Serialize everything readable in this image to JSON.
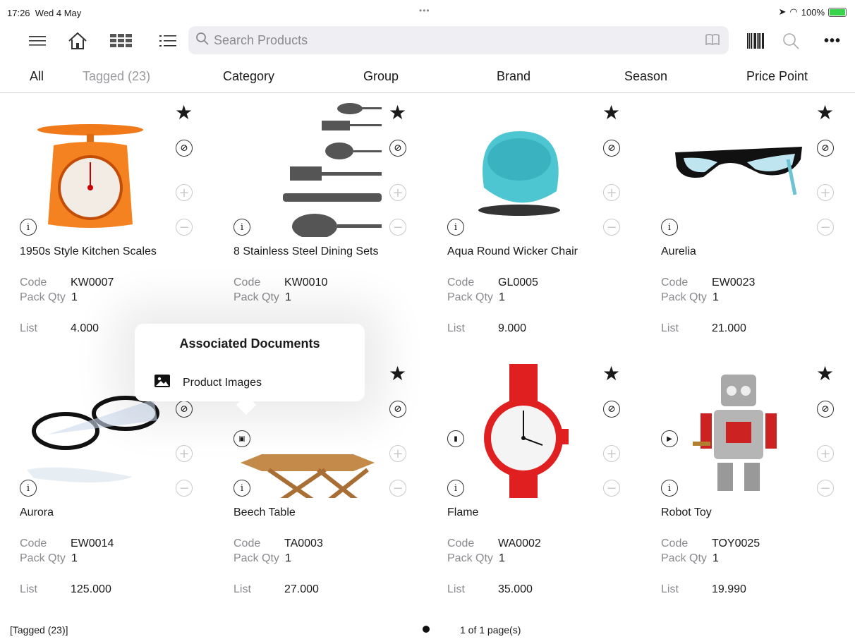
{
  "status_bar": {
    "time": "17:26",
    "date": "Wed 4 May",
    "battery": "100%",
    "dots": "•••"
  },
  "toolbar": {
    "search_placeholder": "Search Products",
    "icons": [
      "menu-icon",
      "home-icon",
      "grid-view-icon",
      "list-view-icon",
      "book-icon",
      "barcode-icon",
      "search-icon",
      "more-icon"
    ]
  },
  "filters": [
    "All",
    "Tagged (23)",
    "Category",
    "Group",
    "Brand",
    "Season",
    "Price Point"
  ],
  "labels": {
    "code": "Code",
    "pack_qty": "Pack Qty",
    "list": "List"
  },
  "products": [
    {
      "name": "1950s Style Kitchen Scales",
      "code": "KW0007",
      "pack_qty": "1",
      "list": "4.000"
    },
    {
      "name": "8 Stainless Steel Dining Sets",
      "code": "KW0010",
      "pack_qty": "1",
      "list": ""
    },
    {
      "name": "Aqua Round Wicker Chair",
      "code": "GL0005",
      "pack_qty": "1",
      "list": "9.000"
    },
    {
      "name": "Aurelia",
      "code": "EW0023",
      "pack_qty": "1",
      "list": "21.000"
    },
    {
      "name": "Aurora",
      "code": "EW0014",
      "pack_qty": "1",
      "list": "125.000"
    },
    {
      "name": "Beech Table",
      "code": "TA0003",
      "pack_qty": "1",
      "list": "27.000"
    },
    {
      "name": "Flame",
      "code": "WA0002",
      "pack_qty": "1",
      "list": "35.000"
    },
    {
      "name": "Robot Toy",
      "code": "TOY0025",
      "pack_qty": "1",
      "list": "19.990"
    }
  ],
  "popover": {
    "title": "Associated Documents",
    "item": "Product Images"
  },
  "footer": {
    "left": "[Tagged (23)]",
    "pages": "1 of 1 page(s)"
  },
  "colors": {
    "accent": "#1a1a1a",
    "muted": "#8a8a8f",
    "search_bg": "#efeff3"
  }
}
